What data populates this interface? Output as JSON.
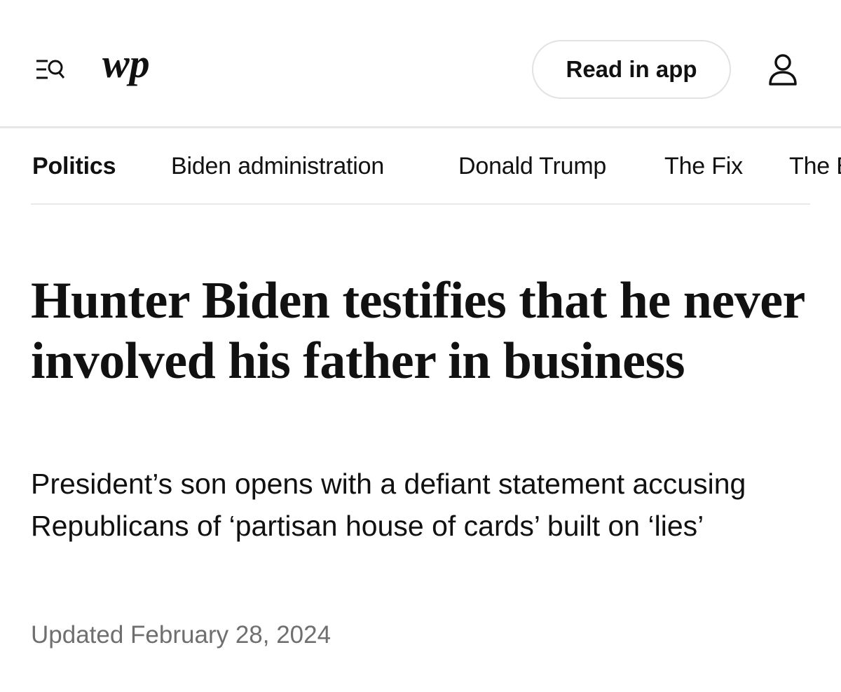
{
  "header": {
    "logo_text": "wp",
    "read_in_app_label": "Read in app",
    "icons": {
      "menu": "menu-search-icon",
      "account": "account-icon"
    }
  },
  "nav": {
    "items": [
      {
        "label": "Politics",
        "active": true
      },
      {
        "label": "Biden administration",
        "active": false
      },
      {
        "label": "Donald Trump",
        "active": false
      },
      {
        "label": "The Fix",
        "active": false
      },
      {
        "label": "The E",
        "active": false
      }
    ]
  },
  "article": {
    "headline": "Hunter Biden testifies that he never involved his father in business",
    "dek": "President’s son opens with a defiant statement accusing Republicans of ‘partisan house of cards’ built on ‘lies’",
    "timestamp": "Updated February 28, 2024"
  }
}
